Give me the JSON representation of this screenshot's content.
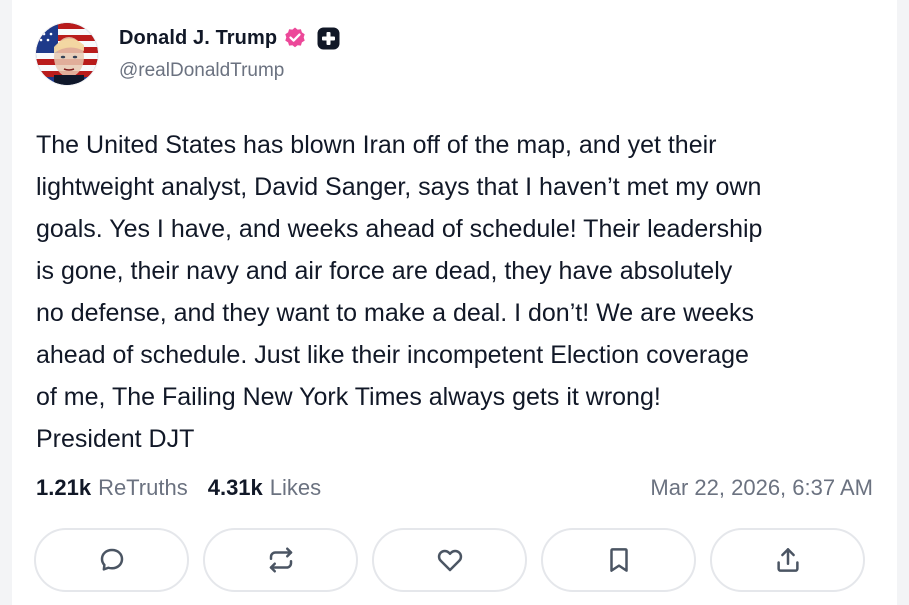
{
  "author": {
    "name": "Donald J. Trump",
    "handle": "@realDonaldTrump",
    "verified_icon": "verified-badge-icon",
    "plus_icon": "plus-badge-icon",
    "verified_color": "#ec4899"
  },
  "post": {
    "text": "The United States has blown Iran off of the map, and yet their\nlightweight analyst, David Sanger, says that I haven’t met my own\ngoals. Yes I have, and weeks ahead of schedule! Their leadership\nis gone, their navy and air force are dead, they have absolutely\nno defense, and they want to make a deal. I don’t! We are weeks\nahead of schedule. Just like their incompetent Election coverage\nof me, The Failing New York Times always gets it wrong!\nPresident DJT"
  },
  "stats": {
    "retruths_count": "1.21k",
    "retruths_label": "ReTruths",
    "likes_count": "4.31k",
    "likes_label": "Likes",
    "timestamp": "Mar 22, 2026, 6:37 AM"
  },
  "actions": [
    {
      "name": "reply",
      "icon": "comment-icon"
    },
    {
      "name": "retruth",
      "icon": "repost-icon"
    },
    {
      "name": "like",
      "icon": "heart-icon"
    },
    {
      "name": "bookmark",
      "icon": "bookmark-icon"
    },
    {
      "name": "share",
      "icon": "share-icon"
    }
  ]
}
